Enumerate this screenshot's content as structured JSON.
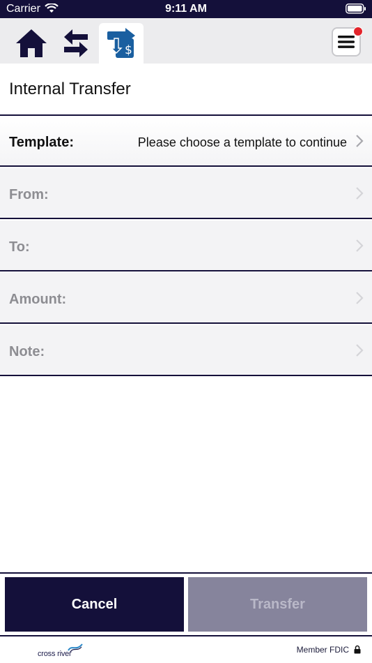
{
  "status_bar": {
    "carrier": "Carrier",
    "time": "9:11 AM"
  },
  "nav": {
    "items": [
      {
        "name": "home",
        "icon": "home-icon",
        "active": false
      },
      {
        "name": "swap",
        "icon": "swap-arrows-icon",
        "active": false
      },
      {
        "name": "transfer",
        "icon": "transfer-dollar-icon",
        "active": true
      }
    ],
    "menu_icon": "hamburger-menu-icon",
    "notification_dot": true
  },
  "page": {
    "title": "Internal Transfer"
  },
  "form": {
    "template": {
      "label": "Template:",
      "value": "Please choose a template to continue"
    },
    "from": {
      "label": "From:",
      "value": ""
    },
    "to": {
      "label": "To:",
      "value": ""
    },
    "amount": {
      "label": "Amount:",
      "value": ""
    },
    "note": {
      "label": "Note:",
      "value": ""
    }
  },
  "actions": {
    "cancel_label": "Cancel",
    "transfer_label": "Transfer",
    "transfer_enabled": false
  },
  "footer": {
    "logo_text": "cross river",
    "member_text": "Member FDIC",
    "lock_icon": "lock-icon"
  },
  "colors": {
    "navy": "#14103a",
    "row_bg": "#f3f3f5",
    "disabled_button": "#86849c",
    "badge": "#e3242b",
    "transfer_icon": "#1a5fa0"
  }
}
